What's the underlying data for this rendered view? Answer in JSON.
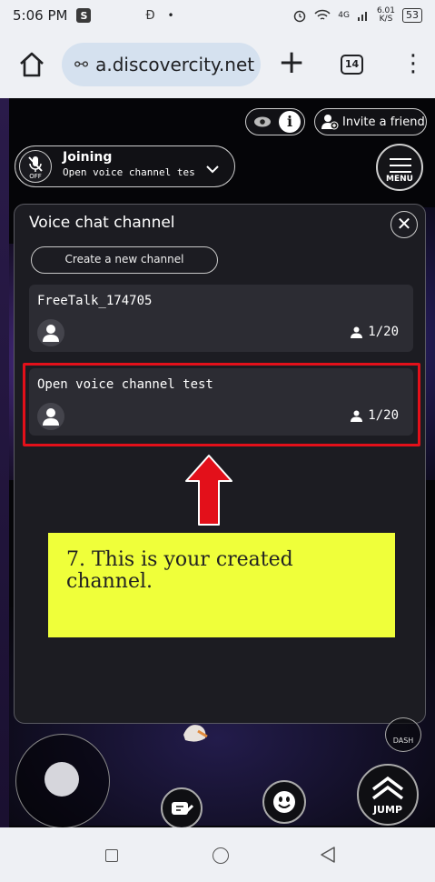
{
  "status_bar": {
    "time": "5:06 PM",
    "app_badge": "S",
    "mid_icon": "Ð",
    "dot": "•",
    "network": "4G",
    "speed_value": "6.01",
    "speed_unit": "K/S",
    "battery": "53"
  },
  "browser": {
    "url": "a.discovercity.net",
    "tab_count": "14",
    "plus_symbol": "+",
    "menu_symbol": "⋮",
    "tune_symbol": "⚯"
  },
  "game": {
    "top_right": {
      "info_symbol": "i",
      "invite_label": "Invite a friend"
    },
    "voice_status": {
      "mic_state": "OFF",
      "status_label": "Joining",
      "channel_label": "Open voice channel tes"
    },
    "menu_label": "MENU",
    "panel": {
      "title": "Voice chat channel",
      "close_symbol": "✕",
      "create_button_label": "Create a new channel",
      "channels": [
        {
          "name": "FreeTalk_174705",
          "count": "1/20"
        },
        {
          "name": "Open voice channel test",
          "count": "1/20"
        }
      ]
    },
    "annotation": {
      "note_text": "7. This is your created channel."
    },
    "controls": {
      "dash_label": "DASH",
      "jump_label": "JUMP"
    }
  }
}
